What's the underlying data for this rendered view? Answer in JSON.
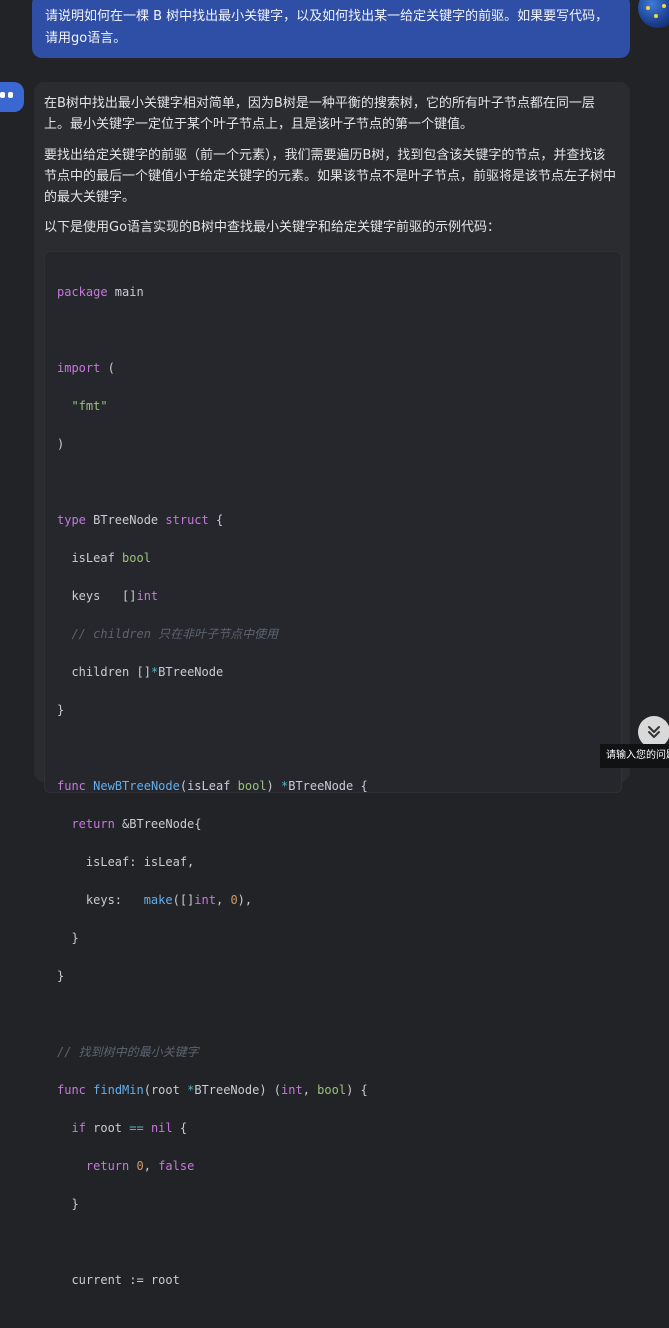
{
  "user_message": {
    "line1": "请说明如何在一棵 B 树中找出最小关键字，以及如何找出某一给定关键字的前驱。如果要写代码，",
    "line2": "请用go语言。"
  },
  "assistant_message": {
    "para1_line1": "在B树中找出最小关键字相对简单，因为B树是一种平衡的搜索树，它的所有叶子节点都在同一层",
    "para1_line2": "上。最小关键字一定位于某个叶子节点上，且是该叶子节点的第一个键值。",
    "para2_line1": "要找出给定关键字的前驱（前一个元素），我们需要遍历B树，找到包含该关键字的节点，并查找该",
    "para2_line2": "节点中的最后一个键值小于给定关键字的元素。如果该节点不是叶子节点，前驱将是该节点左子树中",
    "para2_line3": "的最大关键字。",
    "para3": "以下是使用Go语言实现的B树中查找最小关键字和给定关键字前驱的示例代码："
  },
  "code": {
    "package_kw": "package",
    "package_name": " main",
    "import_kw": "import",
    "import_paren": " (",
    "fmt_string": "\"fmt\"",
    "close_paren": ")",
    "type_kw": "type",
    "type_name": " BTreeNode ",
    "struct_kw": "struct",
    "open_brace": " {",
    "field_isleaf": "isLeaf ",
    "bool_type": "bool",
    "field_keys": "keys   []",
    "int_type": "int",
    "comment_children": "// children 只在非叶子节点中使用",
    "field_children": "children []",
    "star": "*",
    "btreenode": "BTreeNode",
    "close_brace": "}",
    "func_kw": "func",
    "fn_newbtreenode": "NewBTreeNode",
    "params_newbtreenode": "(isLeaf ",
    "paren_close_space": ") ",
    "btreenode_brace": "BTreeNode {",
    "return_kw": "return",
    "amp_btreenode": " &BTreeNode{",
    "isleaf_assign": "isLeaf: isLeaf,",
    "keys_assign": "keys:   ",
    "make_fn": "make",
    "make_args_open": "([]",
    "comma_space": ", ",
    "zero": "0",
    "make_args_close": "),",
    "comment_findmin": "// 找到树中的最小关键字",
    "fn_findmin": "findMin",
    "findmin_params_open": "(root ",
    "findmin_params_close": "BTreeNode) (",
    "findmin_ret_close": ") {",
    "if_kw": "if",
    "root_var": " root ",
    "eq_op": "==",
    "nil_kw": "nil",
    "false_kw": "false",
    "current_assign": "current := root",
    "space": " "
  },
  "tooltip_text": "请输入您的问题"
}
